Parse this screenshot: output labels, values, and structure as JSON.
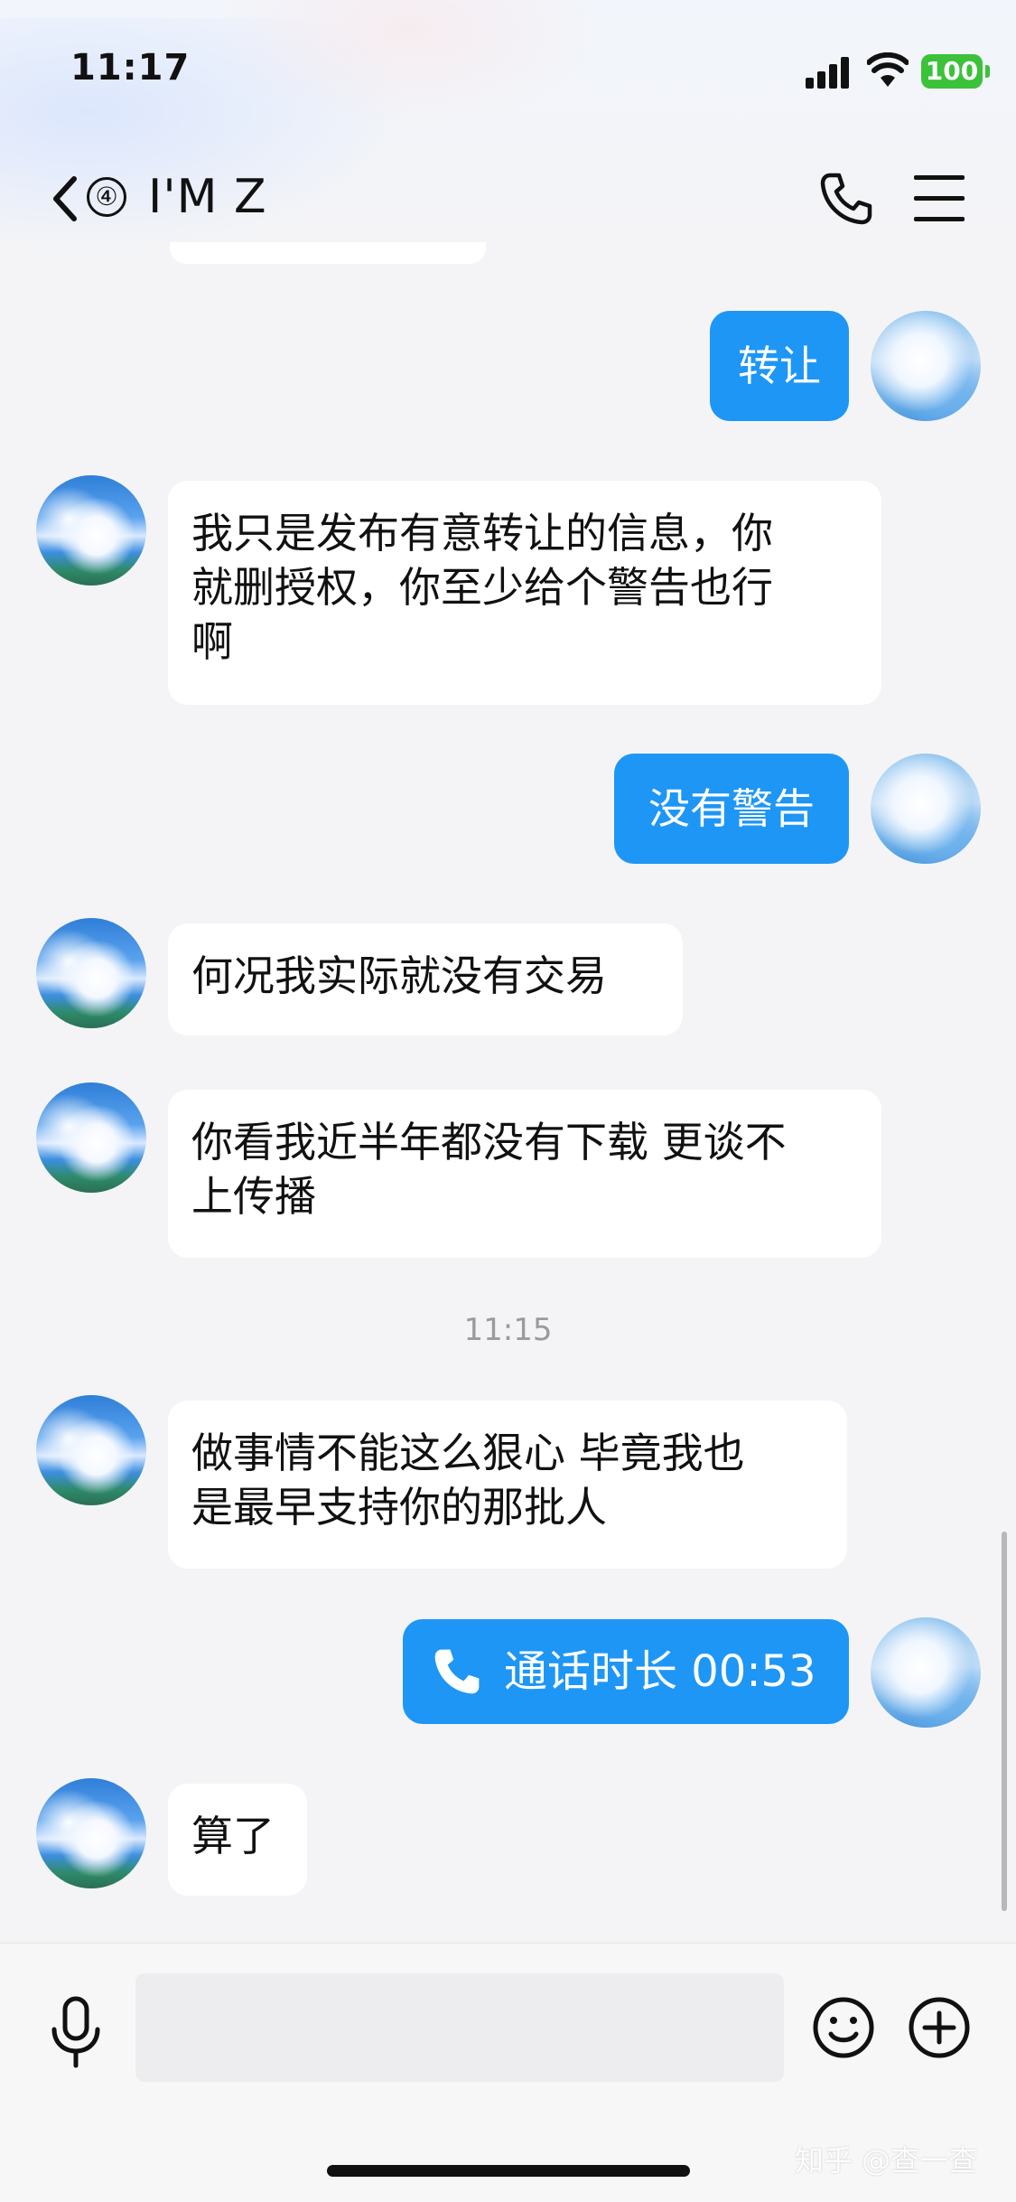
{
  "status_bar": {
    "time": "11:17",
    "battery": "100",
    "battery_color": "#3cc13b"
  },
  "header": {
    "unread_count": "④",
    "title": "I'M Z",
    "icons": [
      "back-chevron-icon",
      "phone-icon",
      "menu-icon"
    ]
  },
  "messages": [
    {
      "side": "out",
      "text": "转让"
    },
    {
      "side": "in",
      "line1": "我只是发布有意转让的信息，你",
      "line2": "就删授权，你至少给个警告也行",
      "line3": "啊"
    },
    {
      "side": "out",
      "text": "没有警告"
    },
    {
      "side": "in",
      "text": "何况我实际就没有交易"
    },
    {
      "side": "in",
      "line1": "你看我近半年都没有下载 更谈不",
      "line2": "上传播"
    },
    {
      "timestamp": "11:15"
    },
    {
      "side": "in",
      "line1": "做事情不能这么狠心  毕竟我也",
      "line2": "是最早支持你的那批人"
    },
    {
      "side": "out",
      "type": "call",
      "text": "通话时长 00:53"
    },
    {
      "side": "in",
      "text": "算了"
    }
  ],
  "input": {
    "icons": [
      "microphone-icon",
      "emoji-icon",
      "plus-icon"
    ]
  },
  "watermark": "知乎 @查一查",
  "colors": {
    "outgoing_bubble": "#1e96f5",
    "incoming_bubble": "#ffffff",
    "background": "#f4f4f6"
  }
}
